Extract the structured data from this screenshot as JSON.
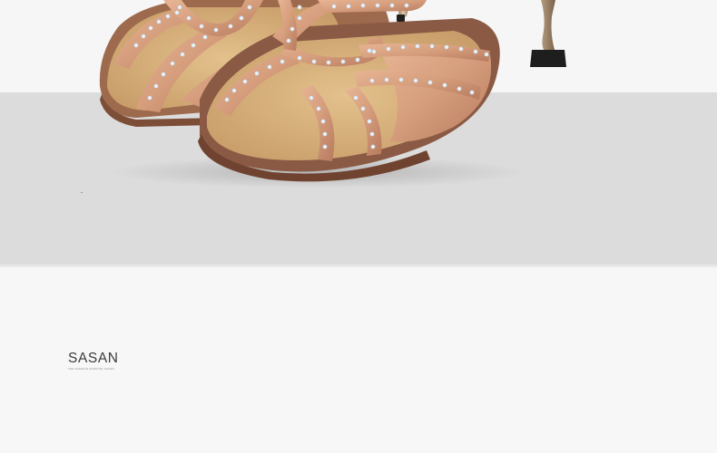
{
  "product_image": {
    "subject": "product-photo",
    "colors": {
      "satin": "#d9a27f",
      "satin_shadow": "#b8775a",
      "insole": "#d8b47e",
      "sole": "#8a5a44",
      "heel": "#b99a75",
      "heel_tip": "#1e1e1e",
      "rhinestone": "#e9eef5"
    }
  },
  "brand": {
    "name": "SASAN",
    "tagline": "THE FASHION DANCING SHOES"
  },
  "colors": {
    "top_background": "#f6f6f6",
    "band_background": "#dcdcdc",
    "bottom_background": "#f7f7f7"
  }
}
